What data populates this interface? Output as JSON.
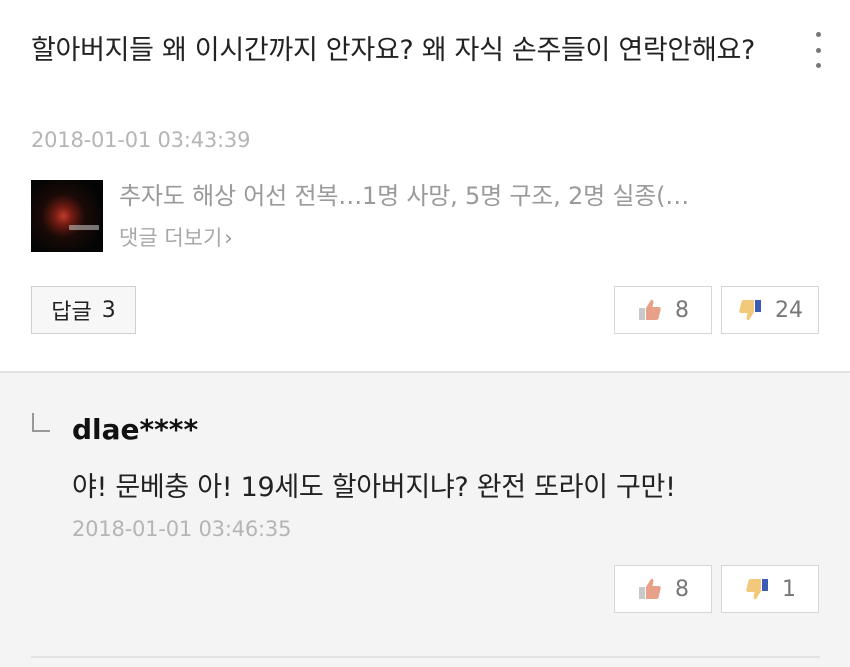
{
  "comment": {
    "text": "할아버지들 왜 이시간까지 안자요? 왜 자식 손주들이 연락안해요?",
    "timestamp": "2018-01-01 03:43:39",
    "article_title": "추자도 해상 어선 전복…1명 사망, 5명 구조, 2명 실종(…",
    "more_comments_label": "댓글 더보기",
    "reply_label": "답글",
    "reply_count": "3",
    "like_count": "8",
    "dislike_count": "24"
  },
  "reply": {
    "author": "dlae****",
    "text": "야! 문베충 아! 19세도 할아버지냐? 완전 또라이 구만!",
    "timestamp": "2018-01-01 03:46:35",
    "like_count": "8",
    "dislike_count": "1"
  },
  "colors": {
    "like_icon": "#e8a089",
    "dislike_icon": "#f2c97a",
    "dislike_cuff": "#3b5bb5"
  },
  "icons": {
    "more": "more-vertical-icon",
    "like": "thumbs-up-icon",
    "dislike": "thumbs-down-icon",
    "chevron": "chevron-right-icon",
    "reply_indent": "reply-indent-icon"
  }
}
